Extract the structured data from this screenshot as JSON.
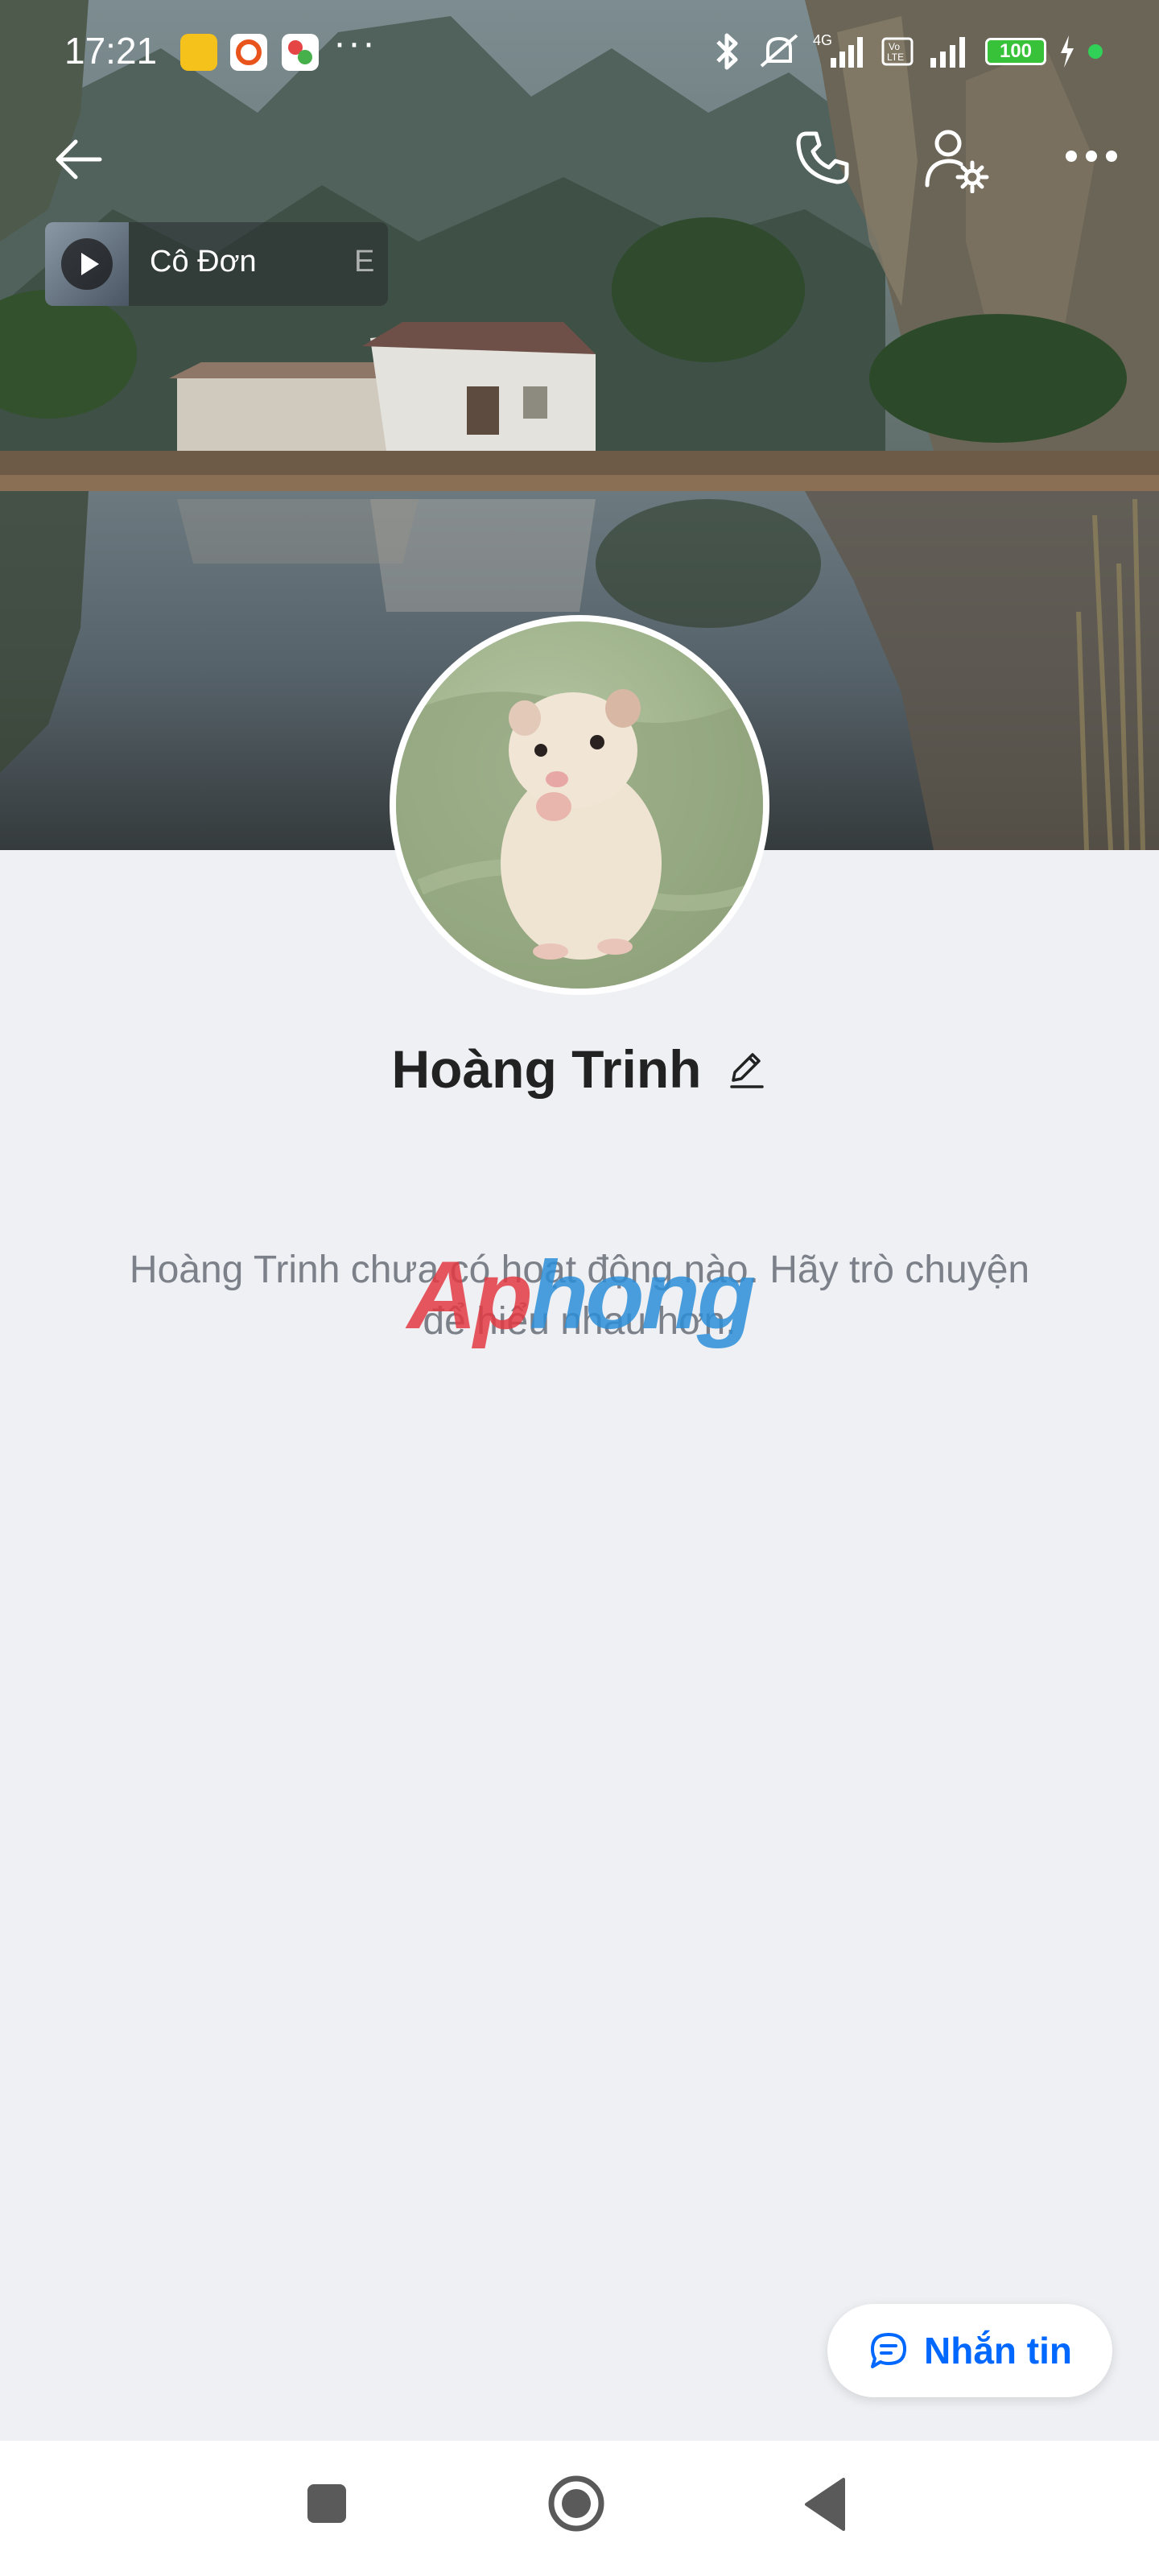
{
  "status_bar": {
    "time": "17:21",
    "dots": "···",
    "battery": "100",
    "network_4g": "4G",
    "network_volte": "Vo LTE"
  },
  "music": {
    "title": "Cô Đơn",
    "tail": "E"
  },
  "profile": {
    "name": "Hoàng Trinh",
    "empty_message": "Hoàng Trinh chưa có hoạt động nào. Hãy trò chuyện để hiểu nhau hơn."
  },
  "watermark": {
    "part1": "Ap",
    "part2": "hong"
  },
  "message_button": {
    "label": "Nhắn tin"
  },
  "icons": {
    "back": "arrow-left-icon",
    "call": "phone-icon",
    "settings": "user-settings-icon",
    "more": "more-icon",
    "edit": "pencil-icon",
    "chat": "chat-bubble-icon"
  },
  "colors": {
    "accent": "#0068ff",
    "background": "#eef0f4",
    "battery": "#38c23a"
  }
}
